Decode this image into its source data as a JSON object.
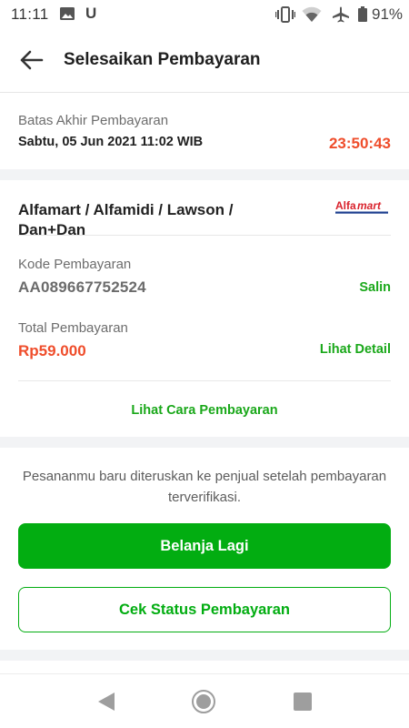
{
  "status_bar": {
    "time": "11:11",
    "u_glyph": "U",
    "battery_text": "91%",
    "icons": [
      "image-icon",
      "vibrate-icon",
      "wifi-icon",
      "airplane-icon",
      "battery-icon"
    ]
  },
  "header": {
    "title": "Selesaikan Pembayaran",
    "back_icon": "arrow-left-icon"
  },
  "deadline": {
    "label": "Batas Akhir Pembayaran",
    "date": "Sabtu, 05 Jun 2021 11:02 WIB",
    "countdown": "23:50:43"
  },
  "merchant": {
    "name": "Alfamart / Alfamidi / Lawson / Dan+Dan",
    "logo_text_left": "Alfa",
    "logo_text_right": "mart"
  },
  "payment_code": {
    "label": "Kode Pembayaran",
    "value": "AA089667752524",
    "copy_label": "Salin"
  },
  "total": {
    "label": "Total Pembayaran",
    "value": "Rp59.000",
    "detail_label": "Lihat Detail"
  },
  "how_to_pay_label": "Lihat Cara Pembayaran",
  "info_message": "Pesananmu baru diteruskan ke penjual setelah pembayaran terverifikasi.",
  "buttons": {
    "shop_again": "Belanja Lagi",
    "check_status": "Cek Status Pembayaran"
  },
  "colors": {
    "brand_green": "#02ad11",
    "link_green": "#1aa81a",
    "accent_red": "#ef4d2b",
    "alfamart_red": "#d9232d"
  }
}
